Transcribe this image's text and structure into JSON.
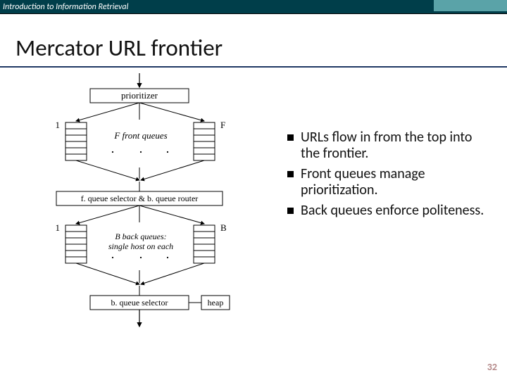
{
  "header": {
    "breadcrumb": "Introduction to Information Retrieval"
  },
  "slide": {
    "title": "Mercator URL frontier",
    "page_number": "32"
  },
  "bullets": [
    "URLs flow in from the top into the frontier.",
    "Front queues manage prioritization.",
    "Back queues enforce politeness."
  ],
  "diagram": {
    "prioritizer": "prioritizer",
    "front_queues_caption": "F front queues",
    "front_left_label": "1",
    "front_right_label": "F",
    "selector_router": "f. queue selector & b. queue router",
    "back_left_label": "1",
    "back_right_label": "B",
    "back_caption_line1": "B back queues:",
    "back_caption_line2": "single host on each",
    "b_queue_selector": "b. queue selector",
    "heap": "heap"
  }
}
